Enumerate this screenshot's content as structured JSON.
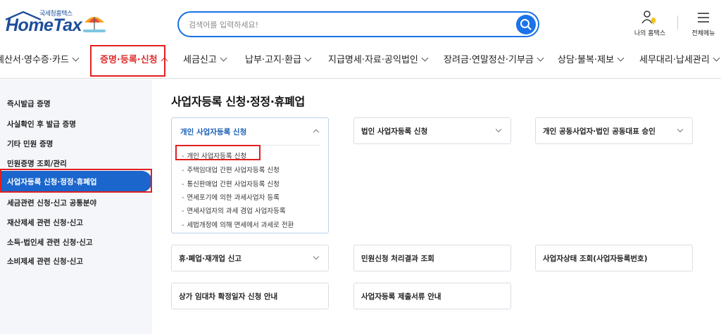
{
  "header": {
    "logo_small": "국세청홈택스",
    "logo_big": "HomeTax",
    "search_placeholder": "검색어를 입력하세요!",
    "my_hometax": "나의 홈택스",
    "full_menu": "전체메뉴"
  },
  "nav": {
    "items": [
      {
        "label": "계산서·영수증·카드"
      },
      {
        "label": "증명·등록·신청"
      },
      {
        "label": "세금신고"
      },
      {
        "label": "납부·고지·환급"
      },
      {
        "label": "지급명세·자료·공익법인"
      },
      {
        "label": "장려금·연말정산·기부금"
      },
      {
        "label": "상담·불복·제보"
      },
      {
        "label": "세무대리·납세관리"
      }
    ],
    "active_index": 1
  },
  "sidebar": {
    "items": [
      {
        "label": "즉시발급 증명"
      },
      {
        "label": "사실확인 후 발급 증명"
      },
      {
        "label": "기타 민원 증명"
      },
      {
        "label": "민원증명 조회/관리"
      },
      {
        "label": "사업자등록 신청·정정·휴폐업"
      },
      {
        "label": "세금관련 신청·신고 공통분야"
      },
      {
        "label": "재산제세 관련 신청·신고"
      },
      {
        "label": "소득·법인세 관련 신청·신고"
      },
      {
        "label": "소비제세 관련 신청·신고"
      }
    ],
    "active_index": 4
  },
  "main": {
    "title": "사업자등록 신청·정정·휴폐업",
    "open_card": {
      "label": "개인 사업자등록 신청",
      "sub_items": [
        {
          "label": "개인 사업자등록 신청"
        },
        {
          "label": "주택임대업 간편 사업자등록 신청"
        },
        {
          "label": "통신판매업 간편 사업자등록 신청"
        },
        {
          "label": "면세포기에 의한 과세사업자 등록"
        },
        {
          "label": "면세사업자의 과세 겸업 사업자등록"
        },
        {
          "label": "세법개정에 의해 면세에서 과세로 전환"
        }
      ]
    },
    "cards": [
      {
        "label": "법인 사업자등록 신청"
      },
      {
        "label": "개인 공동사업자·법인 공동대표 승인"
      },
      {
        "label": "휴·폐업·재개업 신고"
      },
      {
        "label": "민원신청 처리결과 조회"
      },
      {
        "label": "사업자상태 조회(사업자등록번호)"
      },
      {
        "label": "상가 임대차 확정일자 신청 안내"
      },
      {
        "label": "사업자등록 제출서류 안내"
      }
    ]
  },
  "colors": {
    "brand_blue": "#1a73e8",
    "sidebar_active": "#1a66cc",
    "highlight_red": "#e02020"
  },
  "icons": {
    "search": "search-icon",
    "my_hometax": "user-bell-icon",
    "full_menu": "hamburger-icon"
  }
}
